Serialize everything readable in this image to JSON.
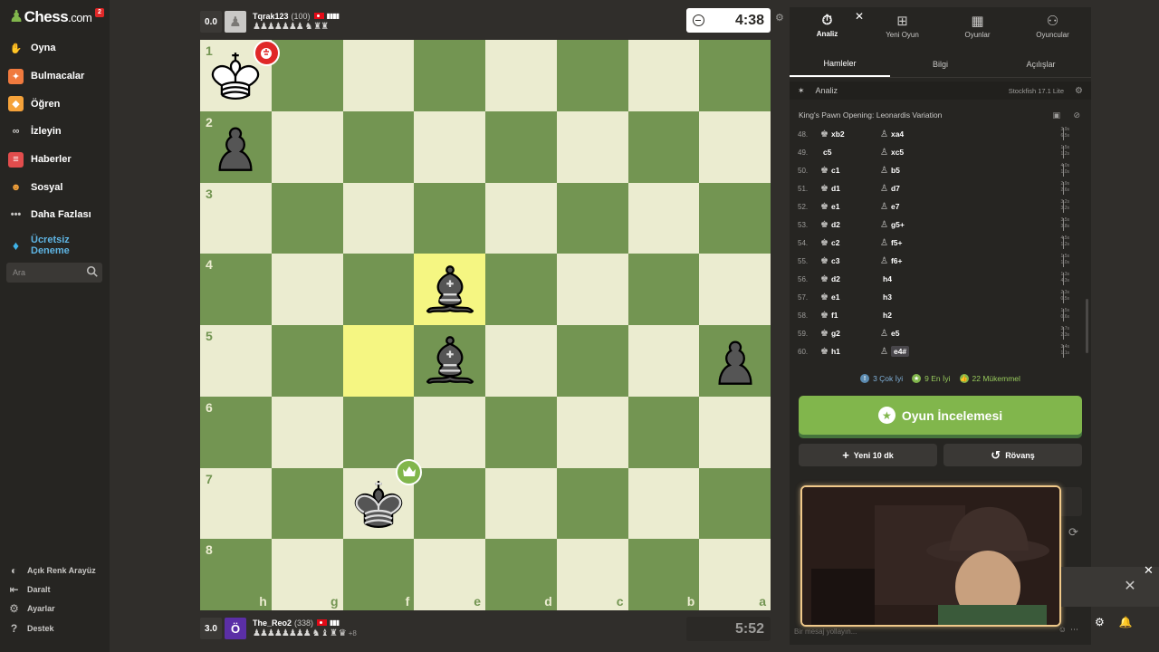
{
  "sidebar": {
    "logo_main": "Chess",
    "logo_suffix": ".com",
    "notification_count": "2",
    "items": [
      {
        "label": "Oyna",
        "icon": "play-icon",
        "color": "#e8e2d4"
      },
      {
        "label": "Bulmacalar",
        "icon": "puzzle-icon",
        "color": "#f07a3e"
      },
      {
        "label": "Öğren",
        "icon": "learn-icon",
        "color": "#f5a23a"
      },
      {
        "label": "İzleyin",
        "icon": "binoculars-icon",
        "color": "#c9c8c6"
      },
      {
        "label": "Haberler",
        "icon": "news-icon",
        "color": "#e24d4d"
      },
      {
        "label": "Sosyal",
        "icon": "social-icon",
        "color": "#f5a23a"
      },
      {
        "label": "Daha Fazlası",
        "icon": "more-icon",
        "color": "#c9c8c6"
      }
    ],
    "trial_label_1": "Ücretsiz",
    "trial_label_2": "Deneme",
    "search_placeholder": "Ara",
    "bottom": [
      {
        "label": "Açık Renk Arayüz",
        "icon": "contrast-icon"
      },
      {
        "label": "Daralt",
        "icon": "collapse-icon"
      },
      {
        "label": "Ayarlar",
        "icon": "settings-icon"
      },
      {
        "label": "Destek",
        "icon": "help-icon"
      }
    ]
  },
  "players": {
    "top": {
      "score": "0.0",
      "name": "Tqrak123",
      "rating": "(100)",
      "clock": "4:38",
      "captured": "♟♟♟♟♟♟♟ ♞ ♜♜"
    },
    "bottom": {
      "score": "3.0",
      "avatar_letter": "Ö",
      "name": "The_Reo2",
      "rating": "(338)",
      "clock": "5:52",
      "captured": "♟♟♟♟♟♟♟♟ ♞ ♝ ♜ ♛",
      "captured_extra": "+8"
    }
  },
  "board": {
    "light_color": "#ebecd0",
    "dark_color": "#739552",
    "ranks": [
      "1",
      "2",
      "3",
      "4",
      "5",
      "6",
      "7",
      "8"
    ],
    "files": [
      "h",
      "g",
      "f",
      "e",
      "d",
      "c",
      "b",
      "a"
    ]
  },
  "panel": {
    "tabs": [
      {
        "label": "Analiz",
        "icon": "stopwatch-icon"
      },
      {
        "label": "Yeni Oyun",
        "icon": "plus-square-icon"
      },
      {
        "label": "Oyunlar",
        "icon": "board-icon"
      },
      {
        "label": "Oyuncular",
        "icon": "players-icon"
      }
    ],
    "subtabs": [
      "Hamleler",
      "Bilgi",
      "Açılışlar"
    ],
    "analysis_label": "Analiz",
    "engine": "Stockfish 17.1 Lite",
    "opening": "King's Pawn Opening: Leonardis Variation",
    "moves": [
      {
        "n": "48.",
        "w": "xb2",
        "wp": "♚",
        "b": "xa4",
        "bp": "♙",
        "t1": "3.9s",
        "t2": "6.5s"
      },
      {
        "n": "49.",
        "w": "c5",
        "wp": "",
        "b": "xc5",
        "bp": "♙",
        "t1": "1.5s",
        "t2": "1.2s"
      },
      {
        "n": "50.",
        "w": "c1",
        "wp": "♚",
        "b": "b5",
        "bp": "♙",
        "t1": "4.0s",
        "t2": "1.0s"
      },
      {
        "n": "51.",
        "w": "d1",
        "wp": "♚",
        "b": "d7",
        "bp": "♙",
        "t1": "2.9s",
        "t2": "2.6s"
      },
      {
        "n": "52.",
        "w": "e1",
        "wp": "♚",
        "b": "e7",
        "bp": "♙",
        "t1": "3.2s",
        "t2": "3.2s"
      },
      {
        "n": "53.",
        "w": "d2",
        "wp": "♚",
        "b": "g5+",
        "bp": "♙",
        "t1": "3.5s",
        "t2": "3.8s"
      },
      {
        "n": "54.",
        "w": "c2",
        "wp": "♚",
        "b": "f5+",
        "bp": "♙",
        "t1": "4.5s",
        "t2": "1.2s"
      },
      {
        "n": "55.",
        "w": "c3",
        "wp": "♚",
        "b": "f6+",
        "bp": "♙",
        "t1": "1.5s",
        "t2": "1.0s"
      },
      {
        "n": "56.",
        "w": "d2",
        "wp": "♚",
        "b": "h4",
        "bp": "",
        "t1": "1.3s",
        "t2": "4.3s"
      },
      {
        "n": "57.",
        "w": "e1",
        "wp": "♚",
        "b": "h3",
        "bp": "",
        "t1": "2.3s",
        "t2": "0.5s"
      },
      {
        "n": "58.",
        "w": "f1",
        "wp": "♚",
        "b": "h2",
        "bp": "",
        "t1": "1.5s",
        "t2": "0.6s"
      },
      {
        "n": "59.",
        "w": "g2",
        "wp": "♚",
        "b": "e5",
        "bp": "♙",
        "t1": "3.7s",
        "t2": "2.3s"
      },
      {
        "n": "60.",
        "w": "h1",
        "wp": "♚",
        "b": "e4#",
        "bp": "♙",
        "t1": "3.4s",
        "t2": "1.1s"
      }
    ],
    "summary": [
      {
        "label": "3 Çok İyi",
        "color": "#5c8bb0",
        "text_color": "#7fb0d9"
      },
      {
        "label": "9 En İyi",
        "color": "#81b64c",
        "text_color": "#97c95c"
      },
      {
        "label": "22 Mükemmel",
        "color": "#81b64c",
        "text_color": "#97c95c"
      }
    ],
    "review_button": "Oyun İncelemesi",
    "new_game_button": "Yeni 10 dk",
    "rematch_button": "Rövanş",
    "chat_placeholder": "Bir mesaj yollayın..."
  }
}
